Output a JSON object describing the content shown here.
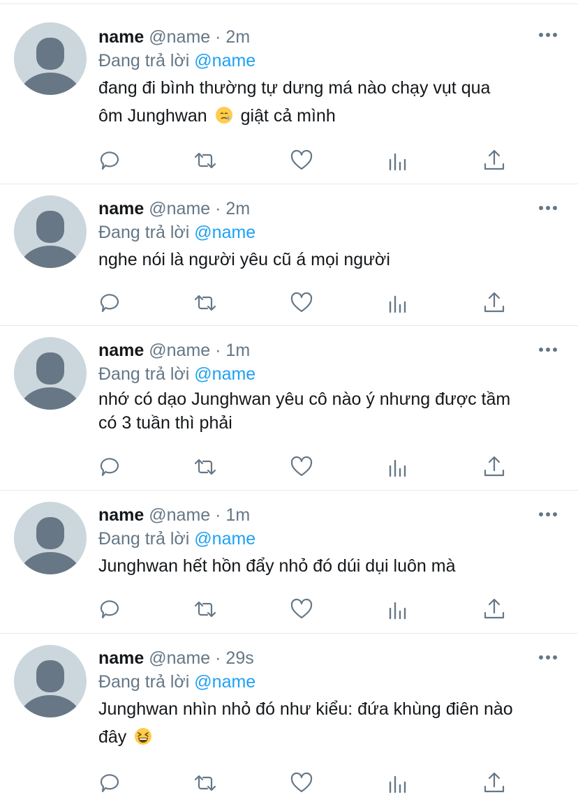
{
  "icons": {
    "more": "more-horizontal-icon",
    "reply": "reply-icon",
    "retweet": "retweet-icon",
    "like": "heart-icon",
    "analytics": "analytics-icon",
    "share": "share-icon",
    "avatar": "default-avatar-icon"
  },
  "colors": {
    "accent": "#1da1f2",
    "muted": "#657786",
    "text": "#14171a",
    "avatar_bg": "#ccd6dd",
    "avatar_fg": "#687785"
  },
  "tweets": [
    {
      "author_name": "name",
      "handle": "@name",
      "separator": "·",
      "time": "2m",
      "reply_prefix": "Đang trả lời",
      "reply_to": "@name",
      "lines": [
        "đang đi bình thường tự dưng má nào chạy vụt qua",
        "ôm Junghwan",
        "giật cả mình"
      ],
      "emoji": "crying-face-emoji"
    },
    {
      "author_name": "name",
      "handle": "@name",
      "separator": "·",
      "time": "2m",
      "reply_prefix": "Đang trả lời",
      "reply_to": "@name",
      "lines": [
        "nghe nói là người yêu cũ á mọi người"
      ]
    },
    {
      "author_name": "name",
      "handle": "@name",
      "separator": "·",
      "time": "1m",
      "reply_prefix": "Đang trả lời",
      "reply_to": "@name",
      "lines": [
        "nhớ có dạo Junghwan yêu cô nào ý nhưng được tầm",
        "có 3 tuần thì phải"
      ]
    },
    {
      "author_name": "name",
      "handle": "@name",
      "separator": "·",
      "time": "1m",
      "reply_prefix": "Đang trả lời",
      "reply_to": "@name",
      "lines": [
        "Junghwan hết hồn đẩy nhỏ đó dúi dụi luôn mà"
      ]
    },
    {
      "author_name": "name",
      "handle": "@name",
      "separator": "·",
      "time": "29s",
      "reply_prefix": "Đang trả lời",
      "reply_to": "@name",
      "lines": [
        "Junghwan nhìn nhỏ đó như kiểu: đứa khùng điên nào",
        "đây"
      ],
      "emoji": "grinning-squinting-face-emoji"
    }
  ]
}
